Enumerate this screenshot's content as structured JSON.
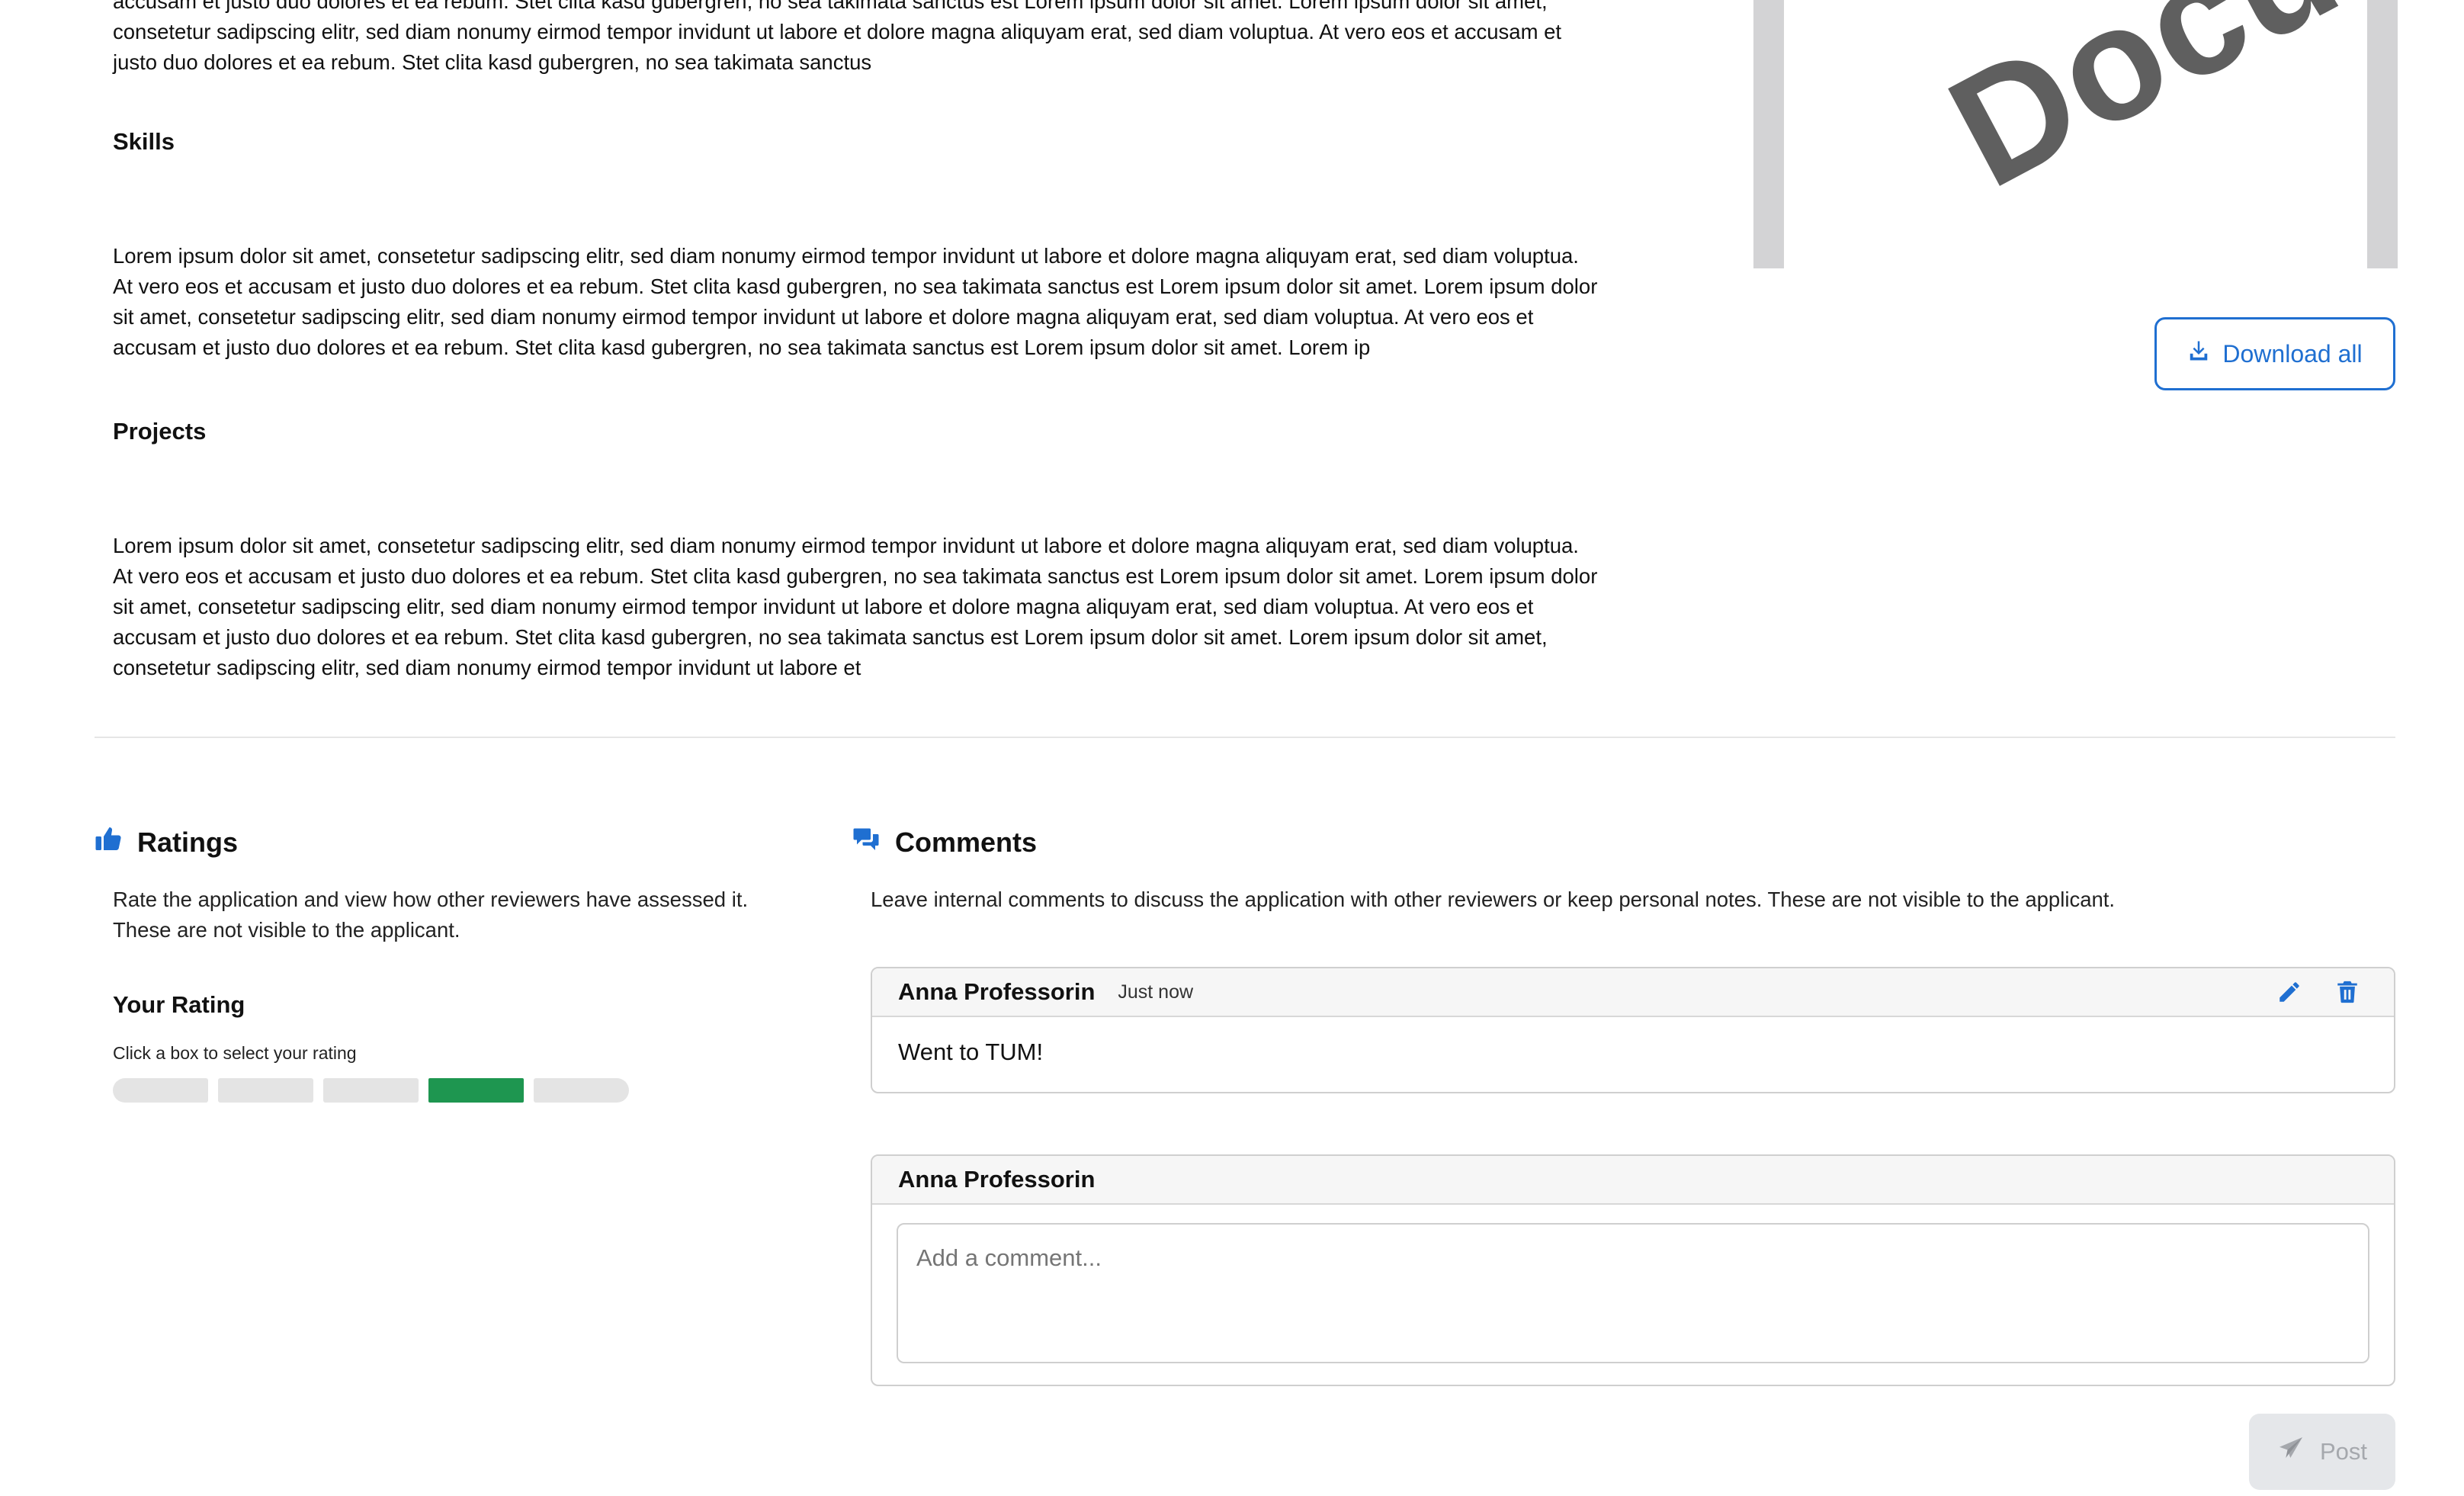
{
  "intro": {
    "line1": "accusam et justo duo dolores et ea rebum. Stet clita kasd gubergren, no sea takimata sanctus est Lorem ipsum dolor sit amet. Lorem ipsum dolor sit amet,",
    "line2": "consetetur sadipscing elitr, sed diam nonumy eirmod tempor invidunt ut labore et dolore magna aliquyam erat, sed diam voluptua. At vero eos et accusam et",
    "line3": "justo duo dolores et ea rebum. Stet clita kasd gubergren, no sea takimata sanctus"
  },
  "skills": {
    "heading": "Skills",
    "lines": [
      "Lorem ipsum dolor sit amet, consetetur sadipscing elitr, sed diam nonumy eirmod tempor invidunt ut labore et dolore magna aliquyam erat, sed diam voluptua.",
      "At vero eos et accusam et justo duo dolores et ea rebum. Stet clita kasd gubergren, no sea takimata sanctus est Lorem ipsum dolor sit amet. Lorem ipsum dolor",
      "sit amet, consetetur sadipscing elitr, sed diam nonumy eirmod tempor invidunt ut labore et dolore magna aliquyam erat, sed diam voluptua. At vero eos et",
      "accusam et justo duo dolores et ea rebum. Stet clita kasd gubergren, no sea takimata sanctus est Lorem ipsum dolor sit amet. Lorem ip"
    ]
  },
  "projects": {
    "heading": "Projects",
    "lines": [
      "Lorem ipsum dolor sit amet, consetetur sadipscing elitr, sed diam nonumy eirmod tempor invidunt ut labore et dolore magna aliquyam erat, sed diam voluptua.",
      "At vero eos et accusam et justo duo dolores et ea rebum. Stet clita kasd gubergren, no sea takimata sanctus est Lorem ipsum dolor sit amet. Lorem ipsum dolor",
      "sit amet, consetetur sadipscing elitr, sed diam nonumy eirmod tempor invidunt ut labore et dolore magna aliquyam erat, sed diam voluptua. At vero eos et",
      "accusam et justo duo dolores et ea rebum. Stet clita kasd gubergren, no sea takimata sanctus est Lorem ipsum dolor sit amet. Lorem ipsum dolor sit amet,",
      "consetetur sadipscing elitr, sed diam nonumy eirmod tempor invidunt ut labore et"
    ]
  },
  "document_preview": {
    "watermark": "Document"
  },
  "download_all_label": "Download all",
  "ratings": {
    "title": "Ratings",
    "description_line1": "Rate the application and view how other reviewers have assessed it.",
    "description_line2": "These are not visible to the applicant.",
    "your_rating_label": "Your Rating",
    "hint": "Click a box to select your rating",
    "scale_max": 5,
    "selected_value": 4
  },
  "comments": {
    "title": "Comments",
    "description": "Leave internal comments to discuss the application with other reviewers or keep personal notes. These are not visible to the applicant.",
    "items": [
      {
        "author": "Anna Professorin",
        "time": "Just now",
        "text": "Went to TUM!"
      }
    ],
    "new_comment": {
      "author": "Anna Professorin",
      "placeholder": "Add a comment..."
    },
    "post_label": "Post"
  },
  "colors": {
    "accent": "#1f6fd1",
    "rating_selected": "#1e9650",
    "rating_empty": "#e4e4e4"
  },
  "icons": {
    "download": "download-icon",
    "thumbs_up": "thumbs-up-icon",
    "comments": "comments-icon",
    "edit": "pencil-icon",
    "delete": "trash-icon",
    "send": "send-icon"
  }
}
